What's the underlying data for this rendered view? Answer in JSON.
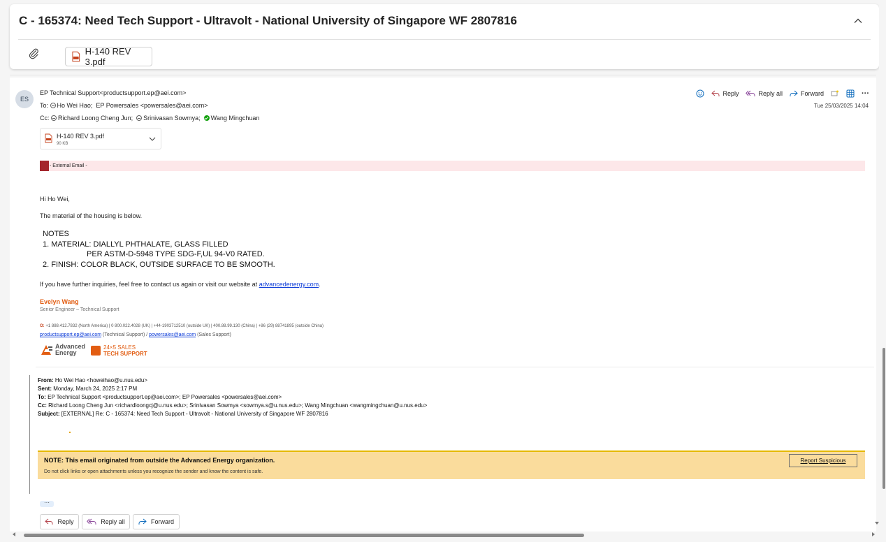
{
  "conversation": {
    "title": "C - 165374: Need Tech Support - Ultravolt - National University of Singapore  WF 2807816",
    "attachment_label": "H-140 REV 3.pdf"
  },
  "message": {
    "avatar_initials": "ES",
    "from": "EP Technical Support<productsupport.ep@aei.com>",
    "to_label": "To:",
    "to_1": "Ho Wei Hao;",
    "to_2": "EP Powersales <powersales@aei.com>",
    "cc_label": "Cc:",
    "cc_1": "Richard Loong Cheng Jun;",
    "cc_2": "Srinivasan Sowmya;",
    "cc_3": "Wang Mingchuan",
    "date": "Tue 25/03/2025 14:04",
    "actions": {
      "reply": "Reply",
      "reply_all": "Reply all",
      "forward": "Forward",
      "more": "···"
    },
    "attachment": {
      "name": "H-140 REV 3.pdf",
      "size": "90 KB"
    },
    "external_banner": "- External Email -",
    "greeting": "Hi Ho Wei,",
    "line1": "The material of the housing is below.",
    "notes": [
      "NOTES",
      "1. MATERIAL: DIALLYL PHTHALATE, GLASS FILLED",
      "PER ASTM-D-5948 TYPE SDG-F,UL 94-V0 RATED.",
      "2. FINISH: COLOR BLACK, OUTSIDE SURFACE TO BE SMOOTH."
    ],
    "closing_prefix": "If you have further inquiries, feel free to contact us again or visit our website at",
    "closing_link": "advancedenergy.com",
    "closing_suffix": ".",
    "signature": {
      "name": "Evelyn Wang",
      "title": "Senior Engineer – Technical Support",
      "contact_prefix": "O:",
      "contact": "+1 888.412.7832 (North America) | 0 800.022.4028 (UK) | +44-1903712510 (outside UK) | 400.88.99.130 (China) | +86 (29) 88741895 (outside China)",
      "email_tech": "productsupport.ep@aei.com",
      "email_tech_note": "(Technical Support) /",
      "email_sales": "powersales@aei.com",
      "email_sales_note": "(Sales Support)",
      "logo_ae_line1": "Advanced",
      "logo_ae_line2": "Energy",
      "logo_247_line1": "24×5 SALES",
      "logo_247_line2": "TECH SUPPORT"
    },
    "forwarded": {
      "from_label": "From:",
      "from": "Ho Wei Hao <howeihao@u.nus.edu>",
      "sent_label": "Sent:",
      "sent": "Monday, March 24, 2025 2:17 PM",
      "to_label": "To:",
      "to": "EP Technical Support <productsupport.ep@aei.com>; EP Powersales <powersales@aei.com>",
      "cc_label": "Cc:",
      "cc": "Richard Loong Cheng Jun <richardloongcj@u.nus.edu>; Srinivasan Sowmya <sowmya.s@u.nus.edu>; Wang Mingchuan <wangmingchuan@u.nus.edu>",
      "subject_label": "Subject:",
      "subject": "[EXTERNAL] Re: C - 165374: Need Tech Support - Ultravolt - National University of Singapore WF 2807816"
    },
    "warning": {
      "title": "NOTE: This email originated from outside the Advanced Energy organization.",
      "subtitle": "Do not click links or open attachments unless you recognize the sender and know the content is safe.",
      "report_button": "Report Suspicious"
    },
    "more_button": "···",
    "bottom_actions": {
      "reply": "Reply",
      "reply_all": "Reply all",
      "forward": "Forward"
    }
  },
  "colors": {
    "accent": "#0f6cbd",
    "external_red": "#a4262c",
    "signature_orange": "#e25d12",
    "warning_yellow": "#fadc9c"
  }
}
